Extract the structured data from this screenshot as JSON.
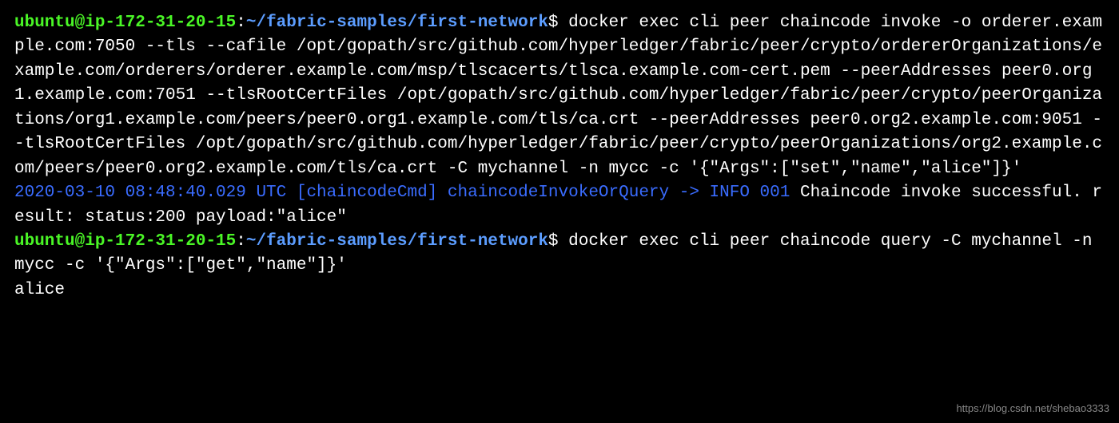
{
  "lines": [
    {
      "type": "prompt-command",
      "user": "ubuntu@ip-172-31-20-15",
      "path": "~/fabric-samples/first-network",
      "command": " docker exec cli peer chaincode invoke -o orderer.example.com:7050 --tls --cafile /opt/gopath/src/github.com/hyperledger/fabric/peer/crypto/ordererOrganizations/example.com/orderers/orderer.example.com/msp/tlscacerts/tlsca.example.com-cert.pem --peerAddresses peer0.org1.example.com:7051 --tlsRootCertFiles /opt/gopath/src/github.com/hyperledger/fabric/peer/crypto/peerOrganizations/org1.example.com/peers/peer0.org1.example.com/tls/ca.crt --peerAddresses peer0.org2.example.com:9051 --tlsRootCertFiles /opt/gopath/src/github.com/hyperledger/fabric/peer/crypto/peerOrganizations/org2.example.com/peers/peer0.org2.example.com/tls/ca.crt -C mychannel -n mycc -c '{\"Args\":[\"set\",\"name\",\"alice\"]}'"
    },
    {
      "type": "log-output",
      "info": "2020-03-10 08:48:40.029 UTC [chaincodeCmd] chaincodeInvokeOrQuery -> INFO 001",
      "rest": " Chaincode invoke successful. result: status:200 payload:\"alice\""
    },
    {
      "type": "prompt-command",
      "user": "ubuntu@ip-172-31-20-15",
      "path": "~/fabric-samples/first-network",
      "command": " docker exec cli peer chaincode query -C mychannel -n mycc -c '{\"Args\":[\"get\",\"name\"]}'"
    },
    {
      "type": "output",
      "text": "alice"
    }
  ],
  "watermark": "https://blog.csdn.net/shebao3333"
}
